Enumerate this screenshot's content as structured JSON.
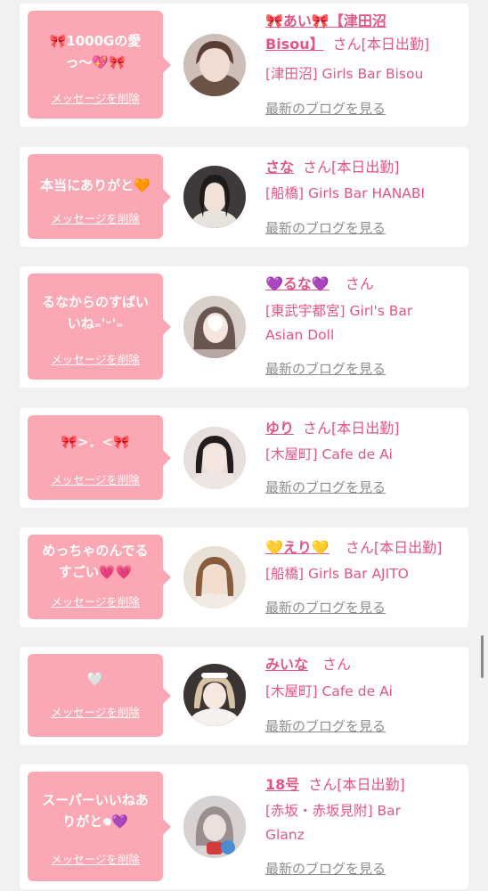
{
  "common": {
    "delete_label": "メッセージを削除",
    "blog_label": "最新のブログを見る",
    "san": "さん",
    "today": "[本日出勤]"
  },
  "items": [
    {
      "message_lines": [
        "🎀1000Gの愛",
        "っ〜💖🎀"
      ],
      "name_lines": [
        "🎀あい🎀【津田沼",
        "Bisou】"
      ],
      "attendance": "[本日出勤]",
      "shop_lines": [
        "[津田沼] Girls Bar Bisou"
      ]
    },
    {
      "message_lines": [
        "本当にありがと🧡"
      ],
      "name_lines": [
        "さな"
      ],
      "attendance": "[本日出勤]",
      "shop_lines": [
        "[船橋] Girls Bar HANABI"
      ]
    },
    {
      "message_lines": [
        "るなからのすばい",
        "いね₌'ᵕ'₌"
      ],
      "name_lines": [
        "💜るな💜"
      ],
      "attendance": "",
      "shop_lines": [
        "[東武宇都宮] Girl's Bar",
        "Asian Doll"
      ]
    },
    {
      "message_lines": [
        "🎀>．<🎀"
      ],
      "name_lines": [
        "ゆり"
      ],
      "attendance": "[本日出勤]",
      "shop_lines": [
        "[木屋町] Cafe de Ai"
      ]
    },
    {
      "message_lines": [
        "めっちゃのんでる",
        "すごい💗💗"
      ],
      "name_lines": [
        "💛えり💛"
      ],
      "attendance": "[本日出勤]",
      "shop_lines": [
        "[船橋] Girls Bar AJITO"
      ]
    },
    {
      "message_lines": [
        "🤍"
      ],
      "name_lines": [
        "みいな"
      ],
      "attendance": "",
      "shop_lines": [
        "[木屋町] Cafe de Ai"
      ]
    },
    {
      "message_lines": [
        "スーパーいいねあ",
        "りがと𖦹💜"
      ],
      "name_lines": [
        "18号"
      ],
      "attendance": "[本日出勤]",
      "shop_lines": [
        "[赤坂・赤坂見附] Bar",
        "Glanz"
      ]
    }
  ],
  "colors": {
    "accent": "#e25589",
    "bubble": "#fca7b4",
    "background": "#f1f1f1",
    "link_gray": "#8d8d8d"
  }
}
